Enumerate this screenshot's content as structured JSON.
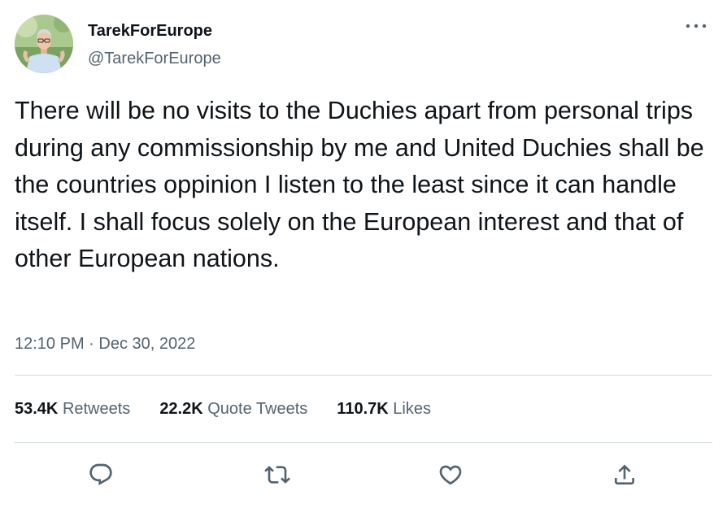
{
  "author": {
    "display_name": "TarekForEurope",
    "handle": "@TarekForEurope",
    "avatar": "profile-photo-man-in-light-blue-shirt"
  },
  "tweet": {
    "text": "There will be no visits to the Duchies apart from personal trips during any commissionship by me and United Duchies shall be the countries oppinion I listen to the least since it can handle itself. I shall focus solely on the European interest and that of other European nations.",
    "timestamp": "12:10 PM · Dec 30, 2022"
  },
  "stats": {
    "retweets_count": "53.4K",
    "retweets_label": "Retweets",
    "quotes_count": "22.2K",
    "quotes_label": "Quote Tweets",
    "likes_count": "110.7K",
    "likes_label": "Likes"
  },
  "icons": {
    "more": "more-horizontal-icon",
    "reply": "reply-icon",
    "retweet": "retweet-icon",
    "like": "heart-icon",
    "share": "share-icon"
  },
  "colors": {
    "text_primary": "#0f1419",
    "text_secondary": "#536471",
    "divider": "#cfd9de"
  }
}
